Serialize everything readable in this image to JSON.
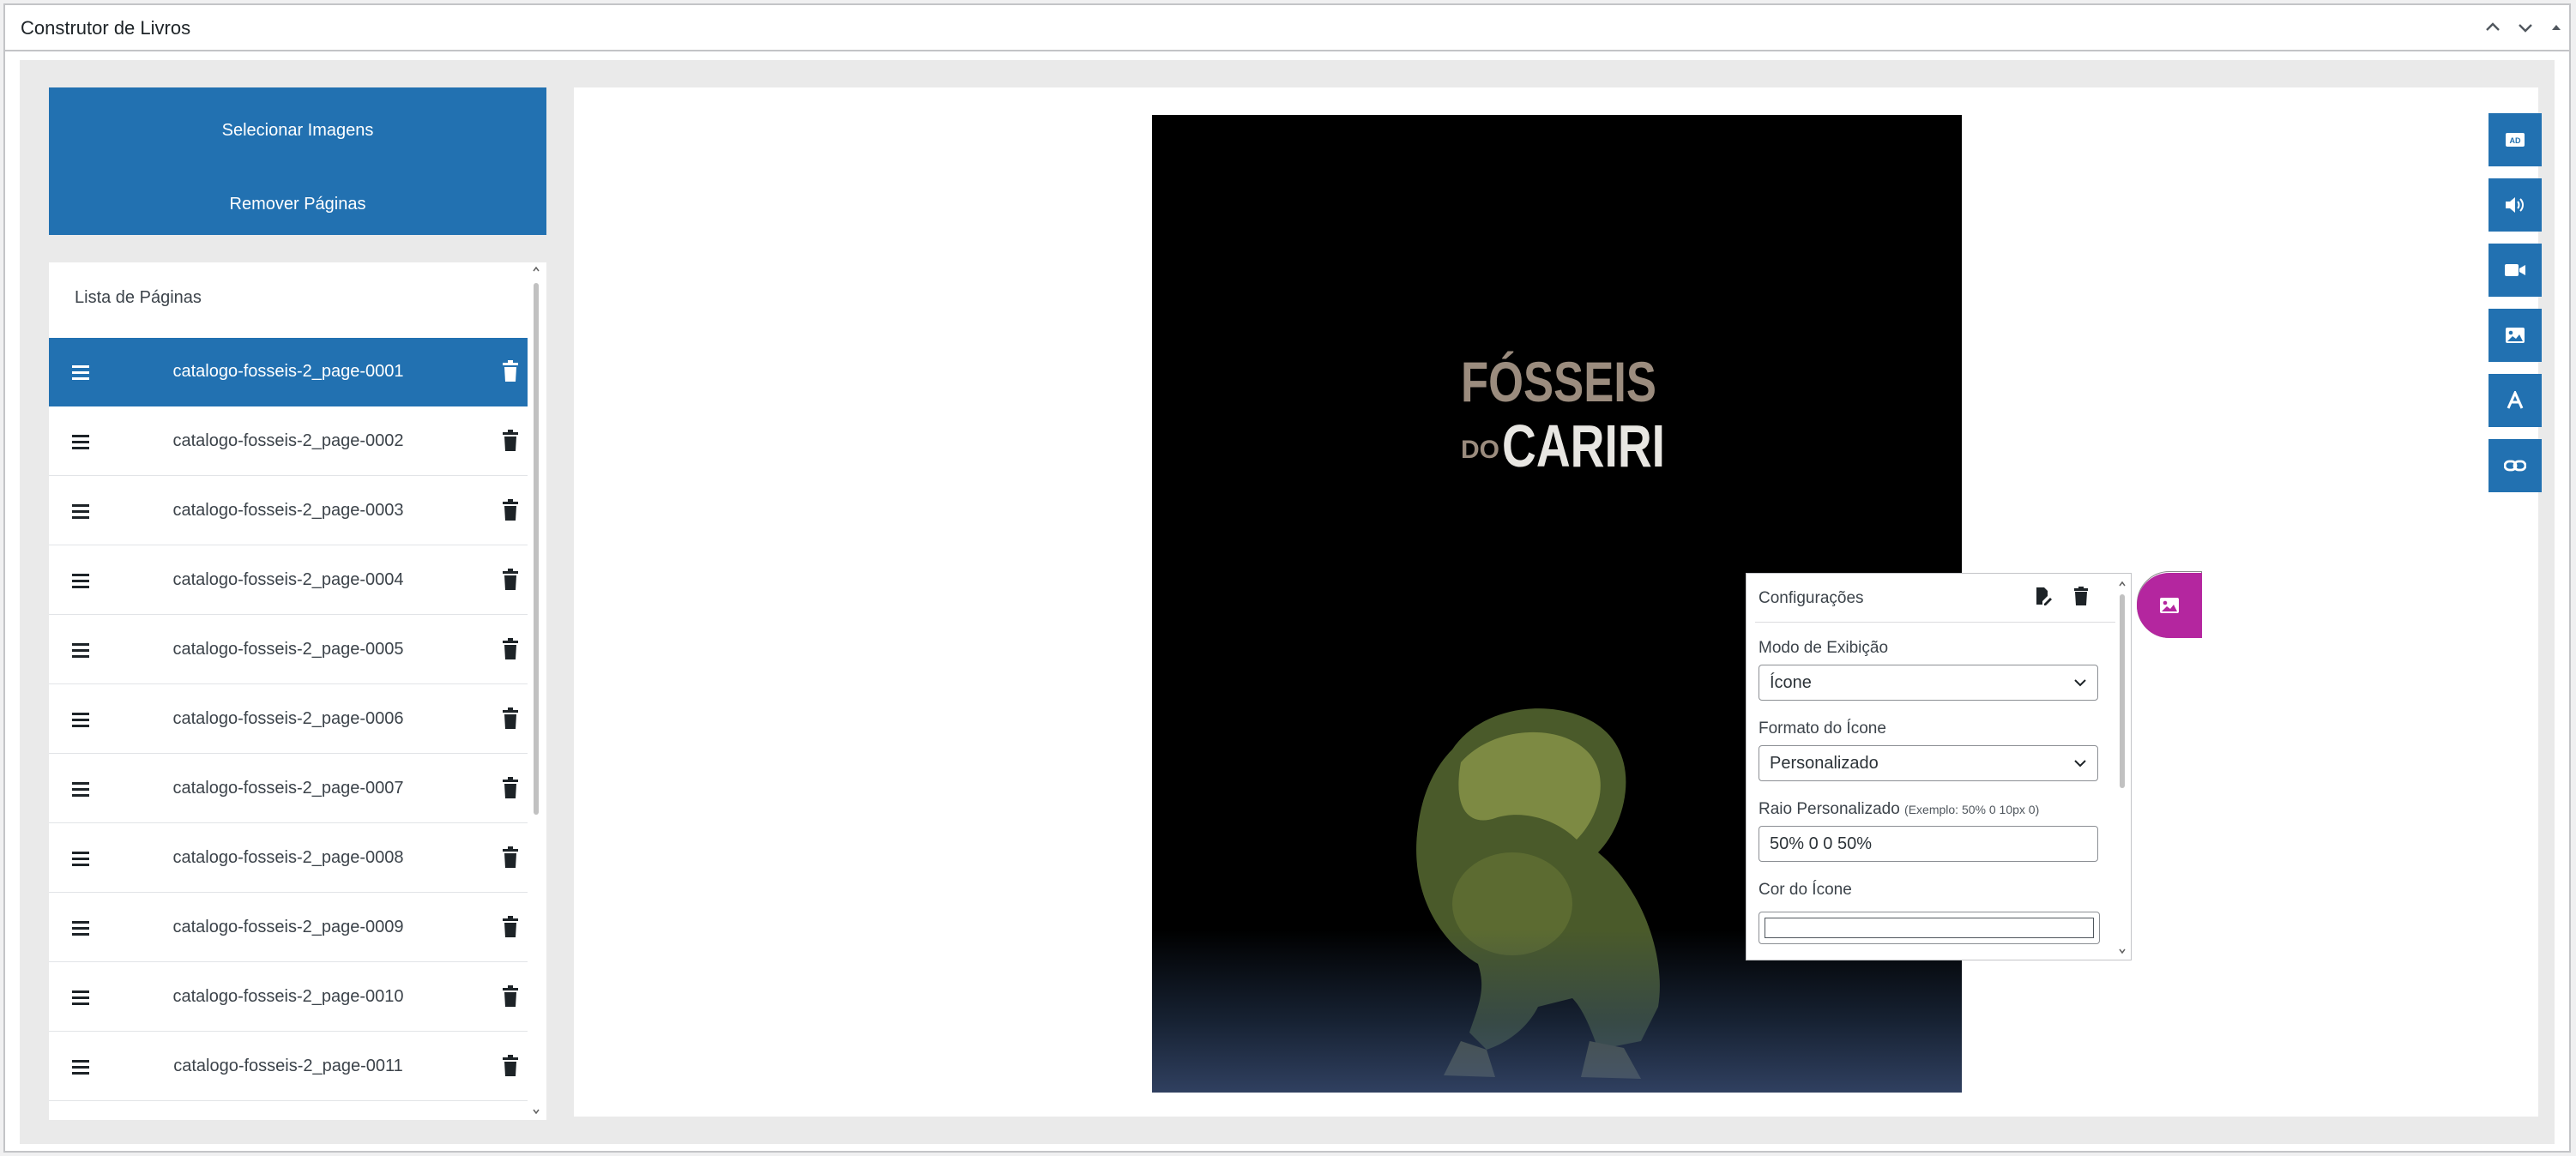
{
  "panel": {
    "title": "Construtor de Livros"
  },
  "actions": {
    "select_images": "Selecionar Imagens",
    "remove_pages": "Remover Páginas"
  },
  "pages_list": {
    "title": "Lista de Páginas",
    "pages": [
      "catalogo-fosseis-2_page-0001",
      "catalogo-fosseis-2_page-0002",
      "catalogo-fosseis-2_page-0003",
      "catalogo-fosseis-2_page-0004",
      "catalogo-fosseis-2_page-0005",
      "catalogo-fosseis-2_page-0006",
      "catalogo-fosseis-2_page-0007",
      "catalogo-fosseis-2_page-0008",
      "catalogo-fosseis-2_page-0009",
      "catalogo-fosseis-2_page-0010",
      "catalogo-fosseis-2_page-0011"
    ],
    "selected_index": 0
  },
  "page_image": {
    "brand_line1": "FÓSSEIS",
    "brand_small": "DO",
    "brand_line2": "CARIRI"
  },
  "settings": {
    "title": "Configurações",
    "display_mode_label": "Modo de Exibição",
    "display_mode_value": "Ícone",
    "icon_format_label": "Formato do Ícone",
    "icon_format_value": "Personalizado",
    "custom_radius_label": "Raio Personalizado",
    "custom_radius_hint": "(Exemplo: 50% 0 10px 0)",
    "custom_radius_value": "50% 0 0 50%",
    "icon_color_label": "Cor do Ícone",
    "icon_color_value": "#ffffff"
  },
  "colors": {
    "primary": "#2271b1",
    "accent": "#b4269f"
  },
  "toolbar_icons": [
    "audio-description-icon",
    "volume-icon",
    "video-icon",
    "image-icon",
    "text-icon",
    "link-icon"
  ]
}
